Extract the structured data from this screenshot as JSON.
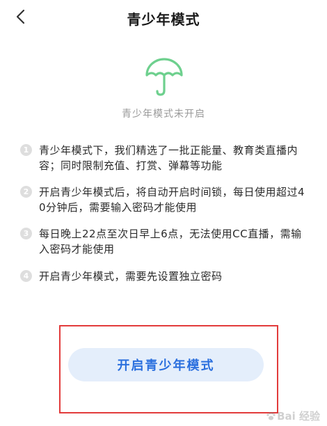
{
  "header": {
    "title": "青少年模式",
    "back_icon": "chevron-left-icon"
  },
  "hero": {
    "icon": "umbrella-icon",
    "icon_color": "#6ed08e",
    "status": "青少年模式未开启"
  },
  "rules": [
    {
      "num": "1",
      "text": "青少年模式下，我们精选了一批正能量、教育类直播内容；同时限制充值、打赏、弹幕等功能"
    },
    {
      "num": "2",
      "text": "开启青少年模式后，将自动开启时间锁，每日使用超过40分钟后，需要输入密码才能使用"
    },
    {
      "num": "3",
      "text": "每日晚上22点至次日早上6点，无法使用CC直播，需输入密码才能使用"
    },
    {
      "num": "4",
      "text": "开启青少年模式，需要先设置独立密码"
    }
  ],
  "actions": {
    "enable_label": "开启青少年模式",
    "accent": "#2a6fde",
    "highlight_color": "#e23b3b"
  },
  "watermark": {
    "text": "Bai 经验"
  }
}
